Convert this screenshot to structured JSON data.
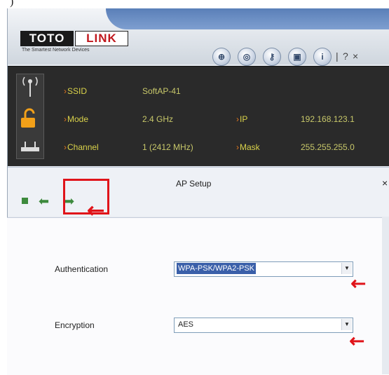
{
  "window": {
    "logo_brand_1": "TOTO",
    "logo_brand_2": "LINK",
    "logo_tagline": "The Smartest Network Devices",
    "toolbar": [
      "wps-icon",
      "settings-icon",
      "key-icon",
      "profile-icon",
      "info-icon"
    ],
    "help_label": "?",
    "close_label": "×"
  },
  "status": {
    "ssid_label": "SSID",
    "ssid_value": "SoftAP-41",
    "mode_label": "Mode",
    "mode_value": "2.4 GHz",
    "channel_label": "Channel",
    "channel_value": "1 (2412 MHz)",
    "ip_label": "IP",
    "ip_value": "192.168.123.1",
    "mask_label": "Mask",
    "mask_value": "255.255.255.0"
  },
  "ap_setup": {
    "title": "AP Setup",
    "close_label": "×",
    "authentication_label": "Authentication",
    "authentication_value": "WPA-PSK/WPA2-PSK",
    "encryption_label": "Encryption",
    "encryption_value": "AES"
  },
  "colors": {
    "accent_red": "#e0141a",
    "status_bg": "#2a2a2a",
    "status_text": "#d9d24a",
    "nav_green": "#3d8a3d",
    "selection_blue": "#3a5fa9"
  }
}
